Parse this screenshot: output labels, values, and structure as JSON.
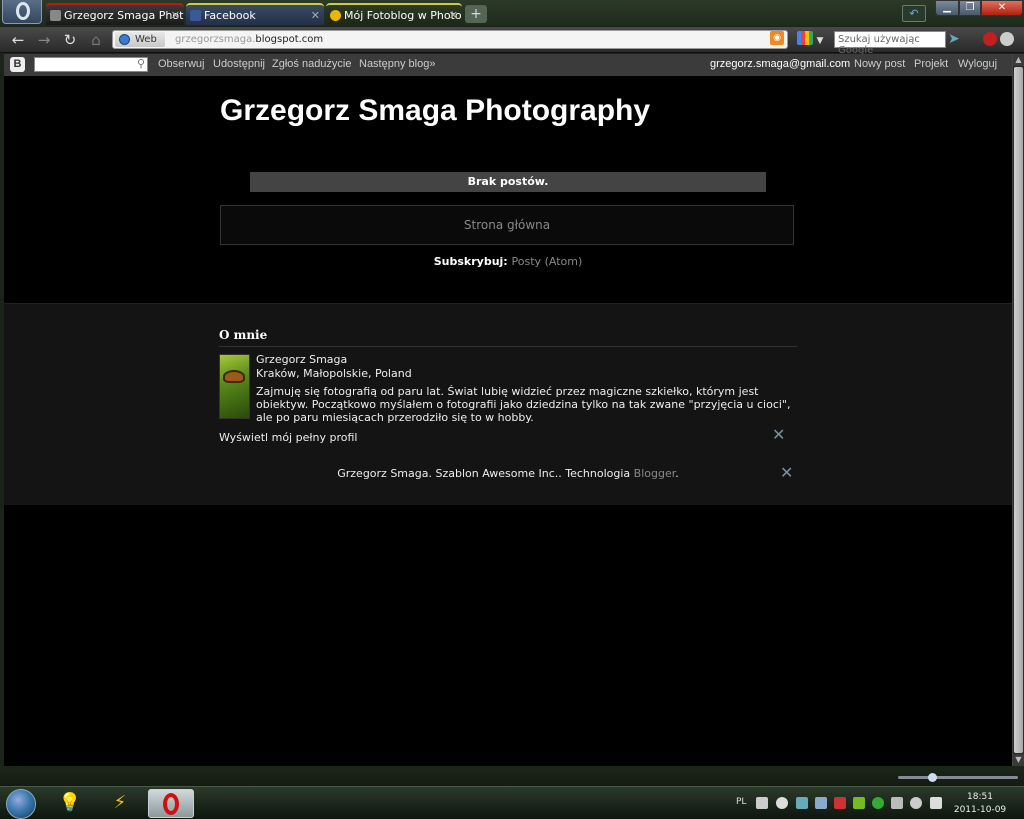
{
  "browser": {
    "tabs": [
      {
        "title": "Grzegorz Smaga Phot..."
      },
      {
        "title": "Facebook"
      },
      {
        "title": "Mój Fotoblog w Photo..."
      }
    ],
    "address": {
      "badge": "Web",
      "url_host_prefix": "grzegorzsmaga.",
      "url_host_domain": "blogspot.com"
    },
    "search_placeholder": "Szukaj używając Google"
  },
  "blogger_nav": {
    "links": [
      "Obserwuj",
      "Udostępnij",
      "Zgłoś nadużycie",
      "Następny blog»"
    ],
    "user": "grzegorz.smaga@gmail.com",
    "right_links": [
      "Nowy post",
      "Projekt",
      "Wyloguj"
    ]
  },
  "blog": {
    "title": "Grzegorz Smaga Photography",
    "no_posts": "Brak postów.",
    "home_link": "Strona główna",
    "subscribe_label": "Subskrybuj:",
    "subscribe_link": "Posty (Atom)"
  },
  "about": {
    "title": "O mnie",
    "name": "Grzegorz Smaga",
    "location": "Kraków, Małopolskie, Poland",
    "description": "Zajmuję się fotografią od paru lat. Świat lubię widzieć przez magiczne szkiełko, którym jest obiektyw. Początkowo myślałem o fotografii jako dziedzina tylko na tak zwane \"przyjęcia u cioci\", ale po paru miesiącach przerodziło się to w hobby.",
    "profile_link": "Wyświetl mój pełny profil"
  },
  "credits": {
    "text": "Grzegorz Smaga. Szablon Awesome Inc.. Technologia",
    "link": "Blogger",
    "end": "."
  },
  "taskbar": {
    "language": "PL",
    "time": "18:51",
    "date": "2011-10-09"
  },
  "colors": {
    "page_bg": "#000000",
    "footer_bg": "#141414",
    "accent_red": "#d01010"
  }
}
